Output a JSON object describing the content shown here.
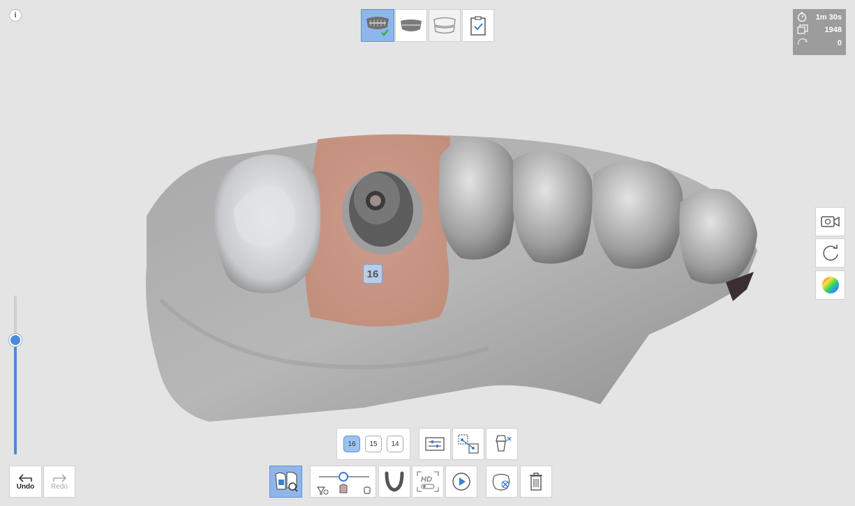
{
  "info_label": "i",
  "stats": {
    "time": "1m 30s",
    "frames": "1948",
    "rotations": "0"
  },
  "scan_steps": [
    {
      "name": "upper-jaw",
      "active": true,
      "done": true
    },
    {
      "name": "lower-jaw",
      "active": false
    },
    {
      "name": "bite",
      "active": false
    },
    {
      "name": "review",
      "active": false
    }
  ],
  "model": {
    "tooth_tag": "16"
  },
  "tooth_selector": [
    "16",
    "15",
    "14"
  ],
  "depth_slider": {
    "level": 0.72
  },
  "undo_label": "Undo",
  "redo_label": "Redo",
  "colors": {
    "accent": "#4a8ad8",
    "selected_bg": "#8fb6ea"
  }
}
